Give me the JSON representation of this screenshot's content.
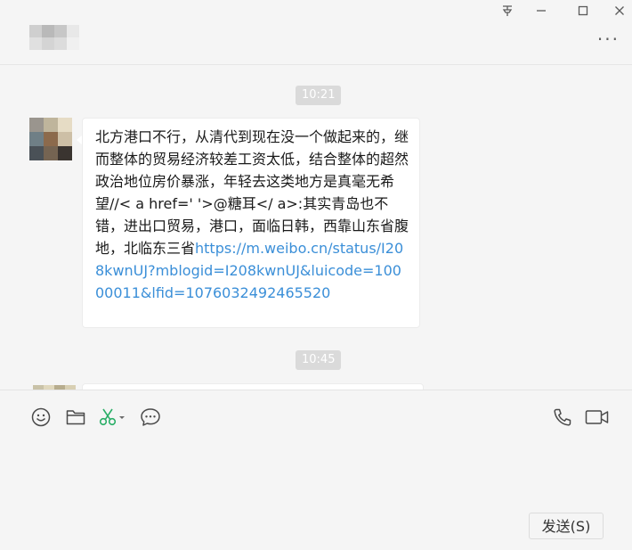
{
  "window": {
    "controls": [
      "pin-icon",
      "minimize-icon",
      "maximize-icon",
      "close-icon"
    ]
  },
  "header": {
    "more_label": "···"
  },
  "messages": [
    {
      "timestamp": "10:21",
      "text": "北方港口不行，从清代到现在没一个做起来的，继而整体的贸易经济较差工资太低，结合整体的超然政治地位房价暴涨，年轻去这类地方是真毫无希望//< a href=' '>@糖耳</ a>:其实青岛也不错，进出口贸易，港口，面临日韩，西靠山东省腹地，北临东三省",
      "link": "https://m.weibo.cn/status/I208kwnUJ?mblogid=I208kwnUJ&luicode=10000011&lfid=1076032492465520"
    },
    {
      "timestamp": "10:45"
    }
  ],
  "toolbar": {
    "left_icons": [
      "emoji-icon",
      "folder-icon",
      "scissors-icon",
      "chat-bubble-icon"
    ],
    "right_icons": [
      "phone-icon",
      "video-icon"
    ]
  },
  "composer": {
    "send_label": "发送(S)"
  }
}
